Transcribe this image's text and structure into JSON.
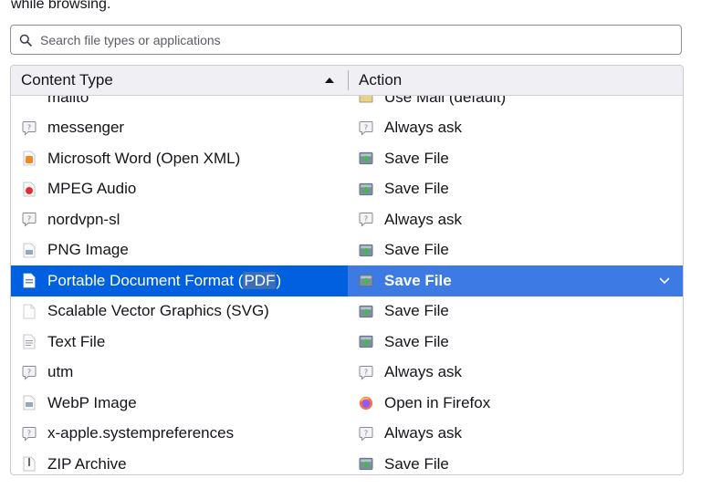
{
  "intro_text": "while browsing.",
  "search": {
    "placeholder": "Search file types or applications"
  },
  "table": {
    "headers": {
      "content_type": "Content Type",
      "action": "Action"
    },
    "partial_row": {
      "type": "mailto",
      "action": "Use Mail (default)"
    },
    "rows": [
      {
        "type": "messenger",
        "type_icon": "chat-icon",
        "action": "Always ask",
        "action_icon": "chat-icon"
      },
      {
        "type": "Microsoft Word (Open XML)",
        "type_icon": "document-orange-icon",
        "action": "Save File",
        "action_icon": "save-file-icon"
      },
      {
        "type": "MPEG Audio",
        "type_icon": "audio-file-icon",
        "action": "Save File",
        "action_icon": "save-file-icon"
      },
      {
        "type": "nordvpn-sl",
        "type_icon": "chat-icon",
        "action": "Always ask",
        "action_icon": "chat-icon"
      },
      {
        "type": "PNG Image",
        "type_icon": "image-file-icon",
        "action": "Save File",
        "action_icon": "save-file-icon"
      },
      {
        "type_before": "Portable Document Format (",
        "type_highlight": "PDF",
        "type_after": ")",
        "type_icon": "pdf-file-icon",
        "action": "Save File",
        "action_icon": "save-file-icon",
        "selected": true
      },
      {
        "type": "Scalable Vector Graphics (SVG)",
        "type_icon": "blank-file-icon",
        "action": "Save File",
        "action_icon": "save-file-icon"
      },
      {
        "type": "Text File",
        "type_icon": "text-file-icon",
        "action": "Save File",
        "action_icon": "save-file-icon"
      },
      {
        "type": "utm",
        "type_icon": "chat-icon",
        "action": "Always ask",
        "action_icon": "chat-icon"
      },
      {
        "type": "WebP Image",
        "type_icon": "image-file-icon",
        "action": "Open in Firefox",
        "action_icon": "firefox-icon"
      },
      {
        "type": "x-apple.systempreferences",
        "type_icon": "chat-icon",
        "action": "Always ask",
        "action_icon": "chat-icon"
      },
      {
        "type": "ZIP Archive",
        "type_icon": "zip-file-icon",
        "action": "Save File",
        "action_icon": "save-file-icon"
      }
    ]
  },
  "colors": {
    "selected_type_bg": "#0060df",
    "selected_action_bg": "#3d7ae4",
    "header_bg": "#f0f0f4"
  }
}
